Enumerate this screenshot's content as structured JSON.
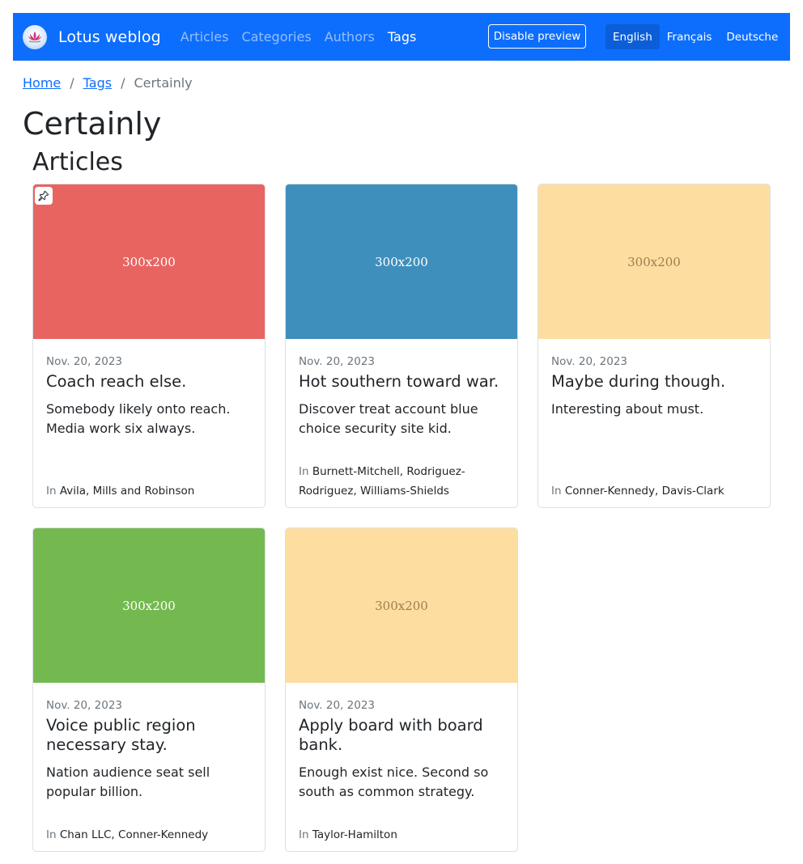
{
  "navbar": {
    "brand": "Lotus weblog",
    "links": [
      "Articles",
      "Categories",
      "Authors",
      "Tags"
    ],
    "active_link": "Tags",
    "preview_button": "Disable preview",
    "languages": [
      "English",
      "Français",
      "Deutsche"
    ],
    "active_language": "English",
    "color": "#0d6efd"
  },
  "breadcrumb": {
    "home": "Home",
    "tags": "Tags",
    "current": "Certainly",
    "separator": "/"
  },
  "page_title": "Certainly",
  "section_title": "Articles",
  "cards_prefix": "In",
  "cards": [
    {
      "image_label": "300x200",
      "image_color": "#e86461",
      "image_text_color": "#ffffff",
      "pinned": true,
      "date": "Nov. 20, 2023",
      "title": "Coach reach else.",
      "text": "Somebody likely onto reach. Media work six always.",
      "categories": [
        "Avila, Mills and Robinson"
      ]
    },
    {
      "image_label": "300x200",
      "image_color": "#3f8fbd",
      "image_text_color": "#ffffff",
      "pinned": false,
      "date": "Nov. 20, 2023",
      "title": "Hot southern toward war.",
      "text": "Discover treat account blue choice security site kid.",
      "categories": [
        "Burnett-Mitchell",
        "Rodriguez-Rodriguez",
        "Williams-Shields"
      ]
    },
    {
      "image_label": "300x200",
      "image_color": "#fddea0",
      "image_text_color": "#a07c4e",
      "pinned": false,
      "date": "Nov. 20, 2023",
      "title": "Maybe during though.",
      "text": "Interesting about must.",
      "categories": [
        "Conner-Kennedy",
        "Davis-Clark"
      ]
    },
    {
      "image_label": "300x200",
      "image_color": "#74b950",
      "image_text_color": "#ffffff",
      "pinned": false,
      "date": "Nov. 20, 2023",
      "title": "Voice public region necessary stay.",
      "text": "Nation audience seat sell popular billion.",
      "categories": [
        "Chan LLC",
        "Conner-Kennedy"
      ]
    },
    {
      "image_label": "300x200",
      "image_color": "#fddea0",
      "image_text_color": "#a07c4e",
      "pinned": false,
      "date": "Nov. 20, 2023",
      "title": "Apply board with board bank.",
      "text": "Enough exist nice. Second so south as common strategy.",
      "categories": [
        "Taylor-Hamilton"
      ]
    }
  ]
}
